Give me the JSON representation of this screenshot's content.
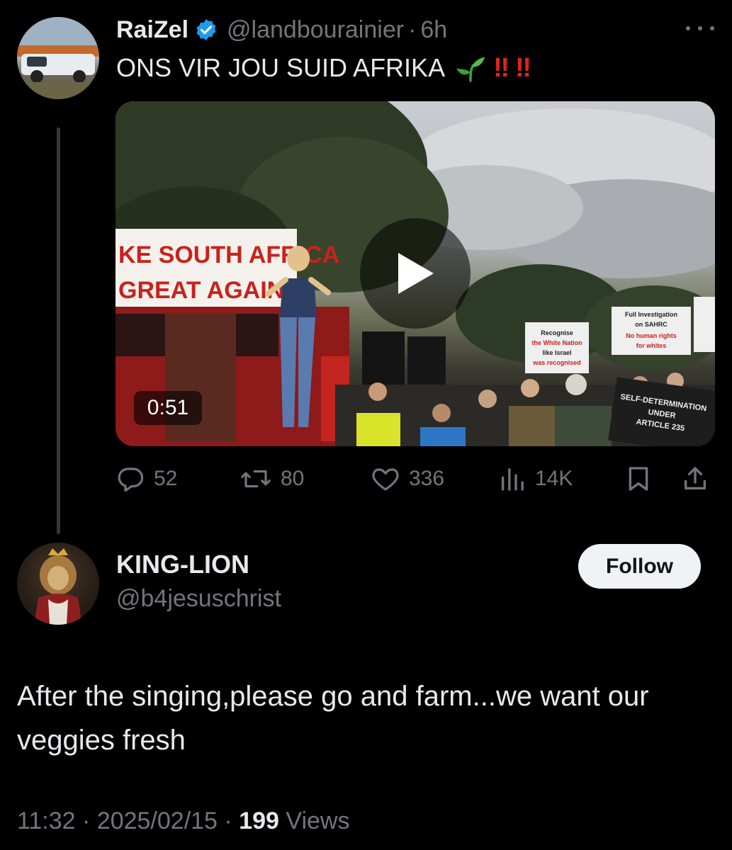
{
  "original_tweet": {
    "author_name": "RaiZel",
    "handle": "@landbourainier",
    "separator": "·",
    "time_ago": "6h",
    "text": "ONS VIR JOU SUID AFRIKA",
    "emojis": [
      "seedling-emoji",
      "double-exclamation-emoji",
      "double-exclamation-emoji"
    ],
    "video": {
      "duration": "0:51",
      "banner_line1": "KE SOUTH AFRICA",
      "banner_line2": "GREAT AGAIN",
      "sign1": [
        "Recognise",
        "the White Nation",
        "like Israel",
        "was recognised"
      ],
      "sign2": [
        "Full Investigation",
        "on SAHRC",
        "No human rights",
        "for whites"
      ],
      "sign3": [
        "SELF-DETERMINATION",
        "UNDER",
        "ARTICLE 235"
      ]
    },
    "stats": {
      "replies": "52",
      "reposts": "80",
      "likes": "336",
      "views": "14K"
    }
  },
  "reply_tweet": {
    "author_name": "KING-LION",
    "handle": "@b4jesuschrist",
    "follow_label": "Follow",
    "text": "After the singing,please go and farm...we want our veggies fresh",
    "time": "11:32",
    "date": "2025/02/15",
    "separator": "·",
    "views_count": "199",
    "views_label": "Views"
  },
  "colors": {
    "background": "#000000",
    "primary_text": "#e7e9ea",
    "secondary_text": "#71767b",
    "verified_blue": "#1d9bf0",
    "follow_button_bg": "#eff3f4",
    "bang_red": "#e0241b"
  }
}
